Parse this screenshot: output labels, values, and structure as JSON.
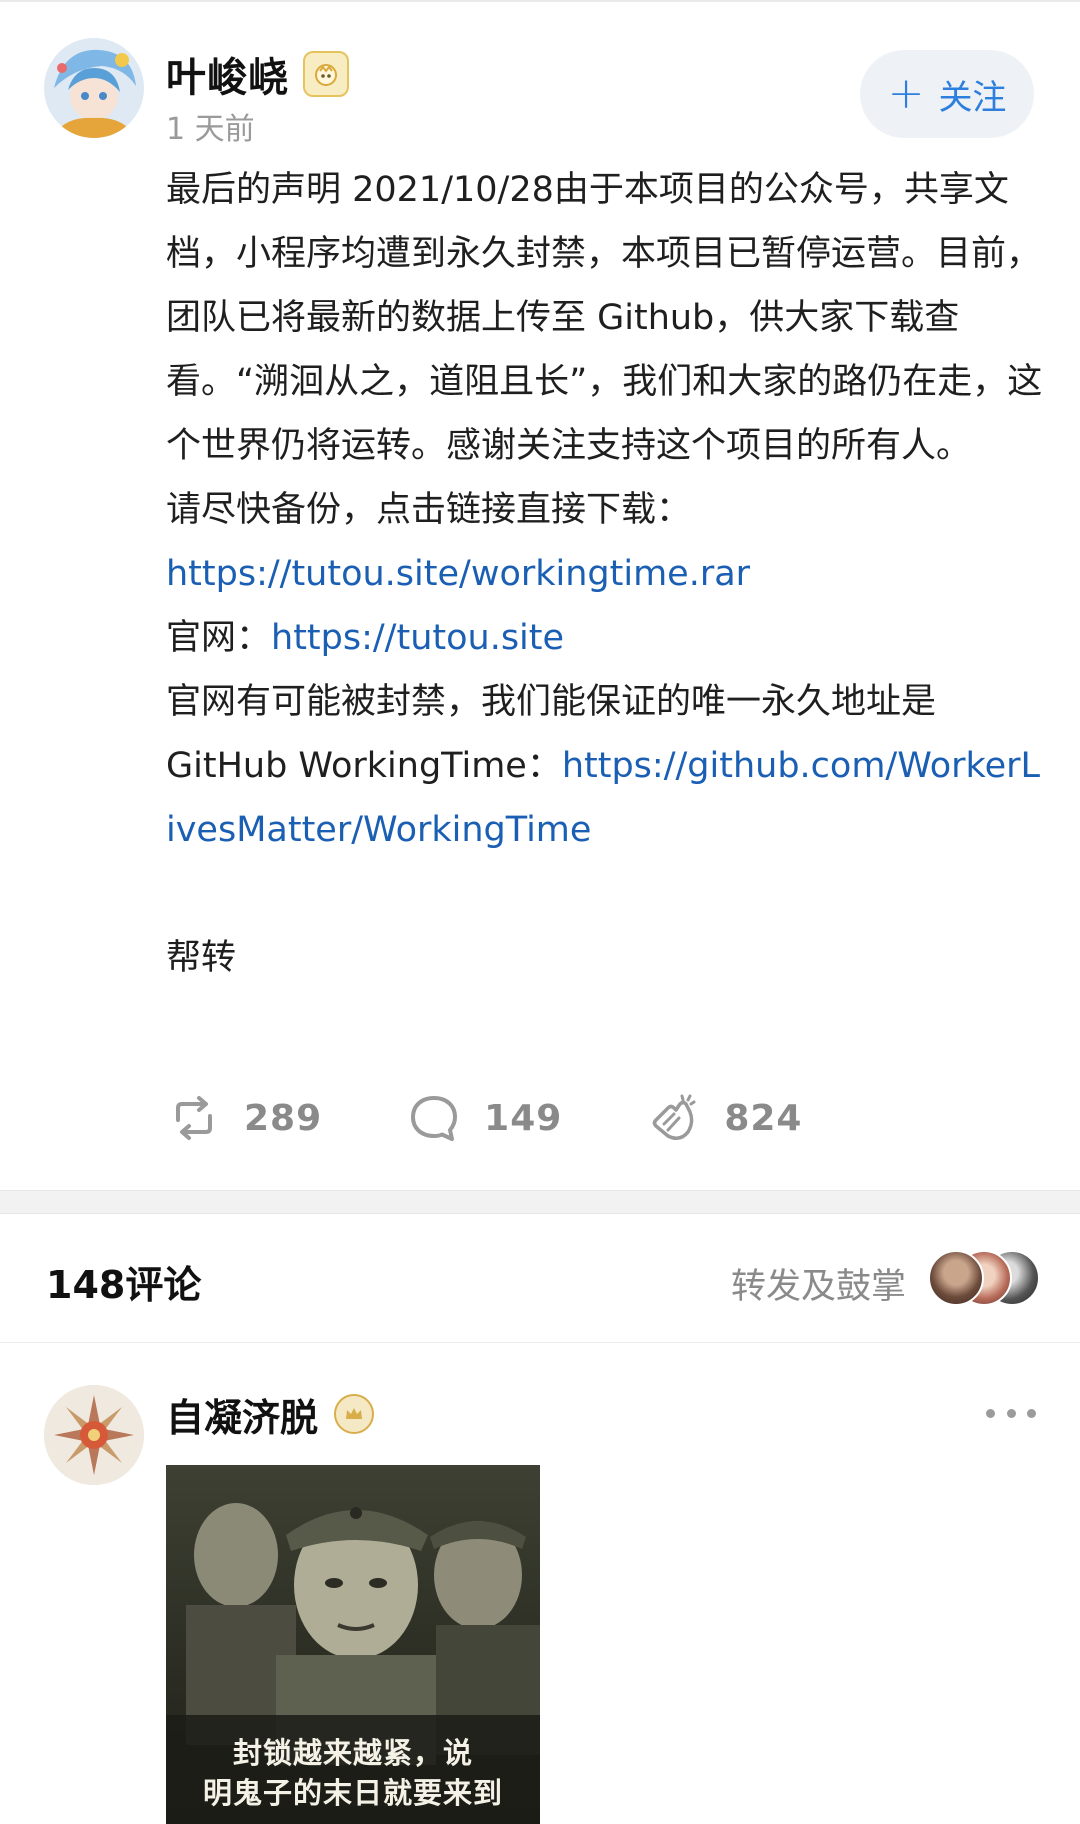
{
  "post": {
    "author": "叶峻峣",
    "time": "1 天前",
    "follow_label": "关注",
    "paragraphs": {
      "p1": "最后的声明 2021/10/28由于本项目的公众号，共享文档，小程序均遭到永久封禁，本项目已暂停运营。目前，团队已将最新的数据上传至 Github，供大家下载查看。“溯洄从之，道阻且长”，我们和大家的路仍在走，这个世界仍将运转。感谢关注支持这个项目的所有人。",
      "p2": "请尽快备份，点击链接直接下载：",
      "link_download": "https://tutou.site/workingtime.rar",
      "official_prefix": "官网：",
      "link_official": "https://tutou.site",
      "p3_prefix": "官网有可能被封禁，我们能保证的唯一永久地址是 GitHub WorkingTime：",
      "link_github": "https://github.com/WorkerLivesMatter/WorkingTime",
      "p4": "帮转"
    },
    "actions": {
      "repost_count": "289",
      "comment_count": "149",
      "like_count": "824"
    }
  },
  "comments_section": {
    "title": "148评论",
    "repost_like_label": "转发及鼓掌"
  },
  "comment": {
    "author": "自凝济脱",
    "image_caption": "封锁越来越紧，说\n明鬼子的末日就要来到"
  },
  "icons": {
    "repost": "repost-icon",
    "comment": "comment-icon",
    "like": "clap-icon",
    "more": "more-dots-icon",
    "plus": "plus-icon"
  },
  "colors": {
    "link": "#1a5fb3",
    "follow_text": "#2e7fdd",
    "muted": "#8a8a8a"
  }
}
